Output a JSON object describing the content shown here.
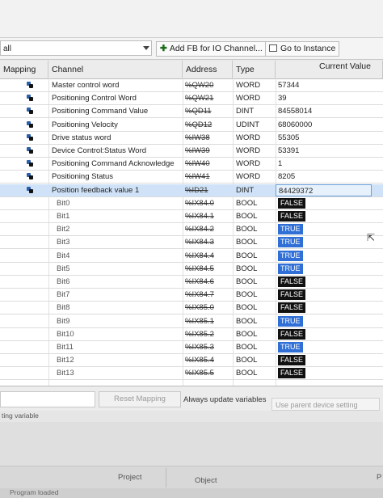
{
  "toolbar": {
    "filter_value": "all",
    "add_fb_label": "Add FB for IO Channel...",
    "go_instance_label": "Go to Instance"
  },
  "columns": {
    "mapping": "Mapping",
    "channel": "Channel",
    "address": "Address",
    "type": "Type",
    "current_value": "Current Value"
  },
  "rows": [
    {
      "channel": "Master control word",
      "address": "%QW20",
      "type": "WORD",
      "value": "57344"
    },
    {
      "channel": "Positioning Control Word",
      "address": "%QW21",
      "type": "WORD",
      "value": "39"
    },
    {
      "channel": "Positioning Command Value",
      "address": "%QD11",
      "type": "DINT",
      "value": "84558014"
    },
    {
      "channel": "Positioning Velocity",
      "address": "%QD12",
      "type": "UDINT",
      "value": "68060000"
    },
    {
      "channel": "Drive status word",
      "address": "%IW38",
      "type": "WORD",
      "value": "55305"
    },
    {
      "channel": "Device Control:Status Word",
      "address": "%IW39",
      "type": "WORD",
      "value": "53391"
    },
    {
      "channel": "Positioning Command Acknowledge",
      "address": "%IW40",
      "type": "WORD",
      "value": "1"
    },
    {
      "channel": "Positioning Status",
      "address": "%IW41",
      "type": "WORD",
      "value": "8205"
    },
    {
      "channel": "Position feedback value 1",
      "address": "%ID21",
      "type": "DINT",
      "value": "84429372"
    }
  ],
  "bits": [
    {
      "channel": "Bit0",
      "address": "%IX84.0",
      "type": "BOOL",
      "value": "FALSE"
    },
    {
      "channel": "Bit1",
      "address": "%IX84.1",
      "type": "BOOL",
      "value": "FALSE"
    },
    {
      "channel": "Bit2",
      "address": "%IX84.2",
      "type": "BOOL",
      "value": "TRUE"
    },
    {
      "channel": "Bit3",
      "address": "%IX84.3",
      "type": "BOOL",
      "value": "TRUE"
    },
    {
      "channel": "Bit4",
      "address": "%IX84.4",
      "type": "BOOL",
      "value": "TRUE"
    },
    {
      "channel": "Bit5",
      "address": "%IX84.5",
      "type": "BOOL",
      "value": "TRUE"
    },
    {
      "channel": "Bit6",
      "address": "%IX84.6",
      "type": "BOOL",
      "value": "FALSE"
    },
    {
      "channel": "Bit7",
      "address": "%IX84.7",
      "type": "BOOL",
      "value": "FALSE"
    },
    {
      "channel": "Bit8",
      "address": "%IX85.0",
      "type": "BOOL",
      "value": "FALSE"
    },
    {
      "channel": "Bit9",
      "address": "%IX85.1",
      "type": "BOOL",
      "value": "TRUE"
    },
    {
      "channel": "Bit10",
      "address": "%IX85.2",
      "type": "BOOL",
      "value": "FALSE"
    },
    {
      "channel": "Bit11",
      "address": "%IX85.3",
      "type": "BOOL",
      "value": "TRUE"
    },
    {
      "channel": "Bit12",
      "address": "%IX85.4",
      "type": "BOOL",
      "value": "FALSE"
    },
    {
      "channel": "Bit13",
      "address": "%IX85.5",
      "type": "BOOL",
      "value": "FALSE"
    }
  ],
  "bottom": {
    "reset_mapping": "Reset Mapping",
    "always_update": "Always update variables",
    "use_parent": "Use parent device setting",
    "variable_fragment": "ting variable"
  },
  "tabs": {
    "project": "Project",
    "object": "Object",
    "edge_p": "P"
  },
  "status": {
    "text": "Program loaded"
  },
  "colors": {
    "true_badge": "#2f6fd6",
    "false_badge": "#111111",
    "selected_row": "#cfe2f7"
  },
  "icons": {
    "mapping": "io-mapping-icon",
    "add": "plus-icon",
    "go": "go-to-instance-icon"
  }
}
